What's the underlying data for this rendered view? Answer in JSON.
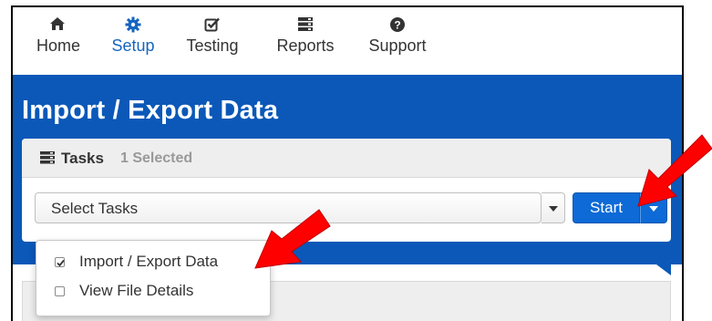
{
  "nav": {
    "items": [
      {
        "label": "Home",
        "icon": "home-icon",
        "active": false
      },
      {
        "label": "Setup",
        "icon": "gear-icon",
        "active": true
      },
      {
        "label": "Testing",
        "icon": "checkbox-icon",
        "active": false
      },
      {
        "label": "Reports",
        "icon": "list-icon",
        "active": false
      },
      {
        "label": "Support",
        "icon": "question-circle-icon",
        "active": false
      }
    ]
  },
  "page": {
    "title": "Import / Export Data"
  },
  "tasks": {
    "header_title": "Tasks",
    "selected_count": "1 Selected",
    "select_placeholder": "Select Tasks",
    "start_label": "Start",
    "menu": [
      {
        "label": "Import / Export Data",
        "checked": true
      },
      {
        "label": "View File Details",
        "checked": false
      }
    ]
  },
  "colors": {
    "banner": "#0b58b8",
    "accent": "#1565c0",
    "button": "#0d6ad6",
    "arrow": "#ff0000"
  }
}
